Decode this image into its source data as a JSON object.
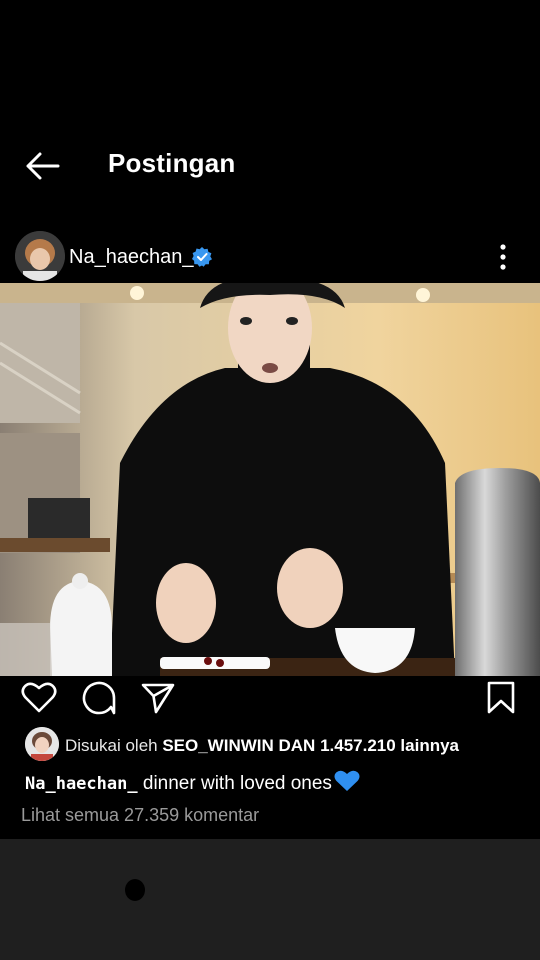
{
  "header": {
    "title": "Postingan",
    "back_icon": "arrow-left-icon"
  },
  "post": {
    "username": "Na_haechan_",
    "verified": true,
    "more_icon": "more-vertical-icon",
    "image_alt": "photo of a person in a black turtleneck cutting cake at a cafe table"
  },
  "actions": {
    "like_icon": "heart-icon",
    "comment_icon": "comment-icon",
    "share_icon": "send-icon",
    "save_icon": "bookmark-icon"
  },
  "likes": {
    "prefix": "Disukai oleh ",
    "liker": "SEO_WINWIN",
    "middle": " DAN ",
    "count": "1.457.210",
    "suffix": " lainnya"
  },
  "caption": {
    "username": "Na_haechan_",
    "text": " dinner with loved ones",
    "emoji_icon": "blue-heart-icon"
  },
  "comments": {
    "view_all": "Lihat semua 27.359 komentar"
  },
  "colors": {
    "background": "#000000",
    "verified": "#3897f0",
    "muted_text": "#9a9a9a",
    "bottom_panel": "#1f1f1f",
    "blue_heart": "#2f8ff0"
  }
}
